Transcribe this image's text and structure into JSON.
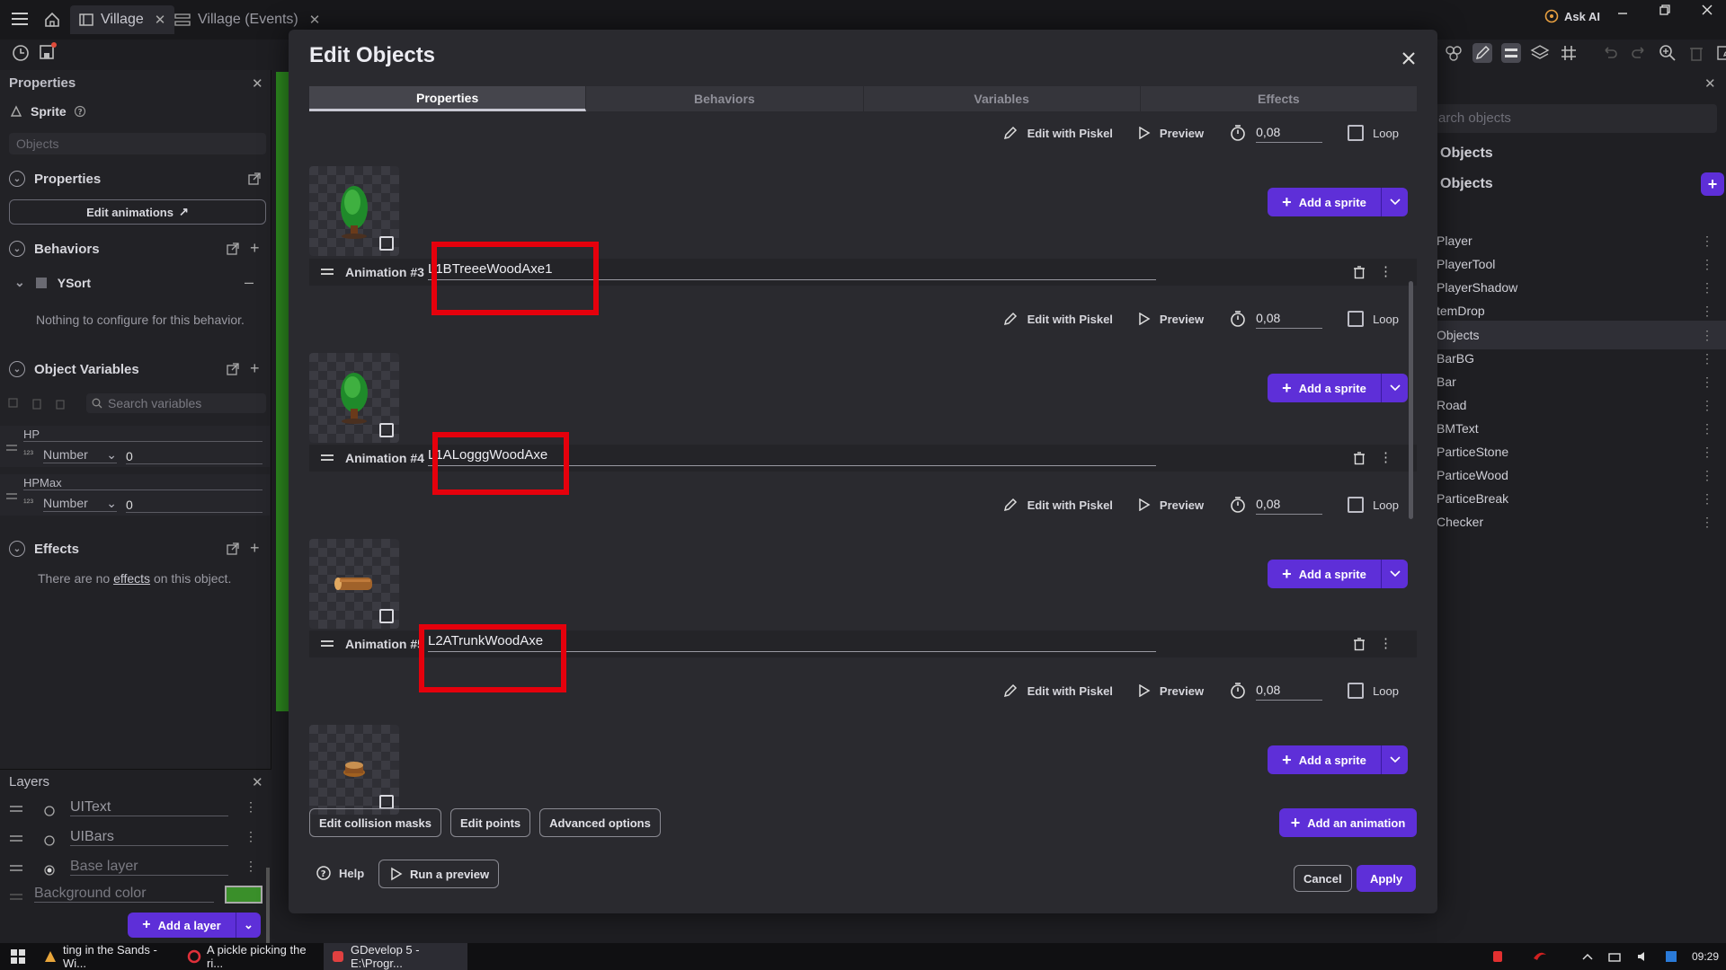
{
  "topbar": {
    "tabs": [
      {
        "label": "Village",
        "active": true
      },
      {
        "label": "Village (Events)",
        "active": false
      }
    ],
    "ask_ai": "Ask AI"
  },
  "left": {
    "properties_title": "Properties",
    "object_kind": "Sprite",
    "search_placeholder": "Objects",
    "sections": {
      "properties": "Properties",
      "edit_animations": "Edit animations",
      "behaviors": "Behaviors",
      "ysort": "YSort",
      "no_config": "Nothing to configure for this behavior.",
      "object_variables": "Object Variables",
      "search_variables": "Search variables",
      "effects": "Effects",
      "no_effects_pre": "There are no ",
      "no_effects_link": "effects",
      "no_effects_post": " on this object."
    },
    "variables": [
      {
        "name": "HP",
        "type": "Number",
        "value": "0"
      },
      {
        "name": "HPMax",
        "type": "Number",
        "value": "0"
      }
    ],
    "layers": {
      "title": "Layers",
      "items": [
        "UIText",
        "UIBars",
        "Base layer"
      ],
      "background_color": "Background color",
      "bg_swatch": "#3a8f2a",
      "add_layer": "Add a layer"
    }
  },
  "modal": {
    "title": "Edit Objects",
    "tabs": [
      "Properties",
      "Behaviors",
      "Variables",
      "Effects"
    ],
    "tools": {
      "edit_piskel": "Edit with Piskel",
      "preview": "Preview",
      "loop": "Loop",
      "add_sprite": "Add a sprite"
    },
    "animations": [
      {
        "label": "Animation #",
        "name": "",
        "speed": "0,08"
      },
      {
        "label": "Animation #3",
        "name": "L1BTreeeWoodAxe1",
        "speed": "0,08"
      },
      {
        "label": "Animation #4",
        "name": "L1ALogggWoodAxe",
        "speed": "0,08"
      },
      {
        "label": "Animation #5",
        "name": "L2ATrunkWoodAxe",
        "speed": "0,08"
      }
    ],
    "buttons": {
      "edit_collision": "Edit collision masks",
      "edit_points": "Edit points",
      "advanced": "Advanced options",
      "add_animation": "Add an animation",
      "help": "Help",
      "run_preview": "Run a preview",
      "cancel": "Cancel",
      "apply": "Apply"
    }
  },
  "right": {
    "search_placeholder": "arch objects",
    "group_header1": "Objects",
    "group_header2": "Objects",
    "items": [
      "Player",
      "PlayerTool",
      "PlayerShadow",
      "temDrop",
      "Objects",
      "BarBG",
      "Bar",
      "Road",
      "BMText",
      "ParticeStone",
      "ParticeWood",
      "ParticeBreak",
      "Checker"
    ],
    "selected_index": 4
  },
  "taskbar": {
    "items": [
      "ting in the Sands - Wi...",
      "A pickle picking the ri...",
      "GDevelop 5 - E:\\Progr..."
    ],
    "clock": "09:29"
  },
  "colors": {
    "accent": "#5e2fd8",
    "highlight": "#e5000c"
  }
}
